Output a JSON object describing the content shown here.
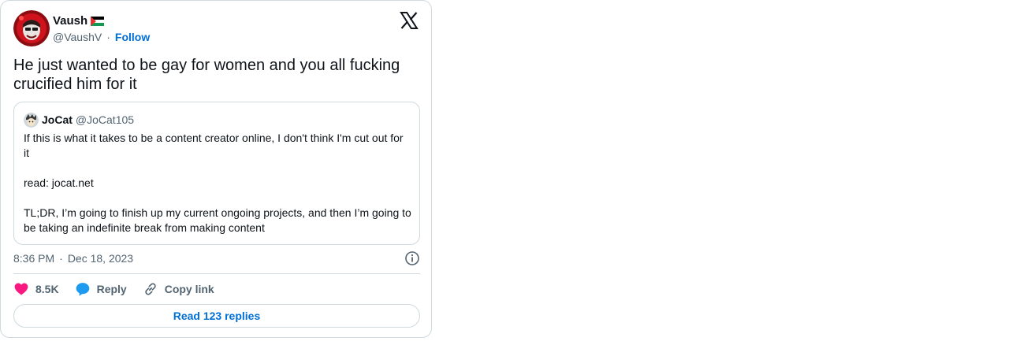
{
  "tweet": {
    "author": {
      "name": "Vaush",
      "handle": "@VaushV",
      "follow_label": "Follow",
      "flag_icon": "palestine-flag-icon"
    },
    "text": "He just wanted to be gay for women and you all fucking crucified him for it",
    "timestamp_time": "8:36 PM",
    "timestamp_date": "Dec 18, 2023",
    "separator": "·"
  },
  "quoted_tweet": {
    "author": {
      "name": "JoCat",
      "handle": "@JoCat105"
    },
    "paragraphs": [
      "If this is what it takes to be a content creator online, I don't think I'm cut out for it",
      "read: jocat.net",
      "TL;DR, I’m going to finish up my current ongoing projects, and then I’m going to be taking an indefinite break from making content"
    ]
  },
  "actions": {
    "like_count": "8.5K",
    "reply_label": "Reply",
    "copy_link_label": "Copy link",
    "read_replies_label": "Read 123 replies"
  },
  "colors": {
    "like": "#f91880",
    "reply": "#1d9bf0",
    "link": "#006fd6",
    "border": "#cfd9de",
    "muted": "#536471"
  },
  "icons": [
    "x-logo-icon",
    "info-icon",
    "heart-icon",
    "reply-bubble-icon",
    "link-icon"
  ]
}
